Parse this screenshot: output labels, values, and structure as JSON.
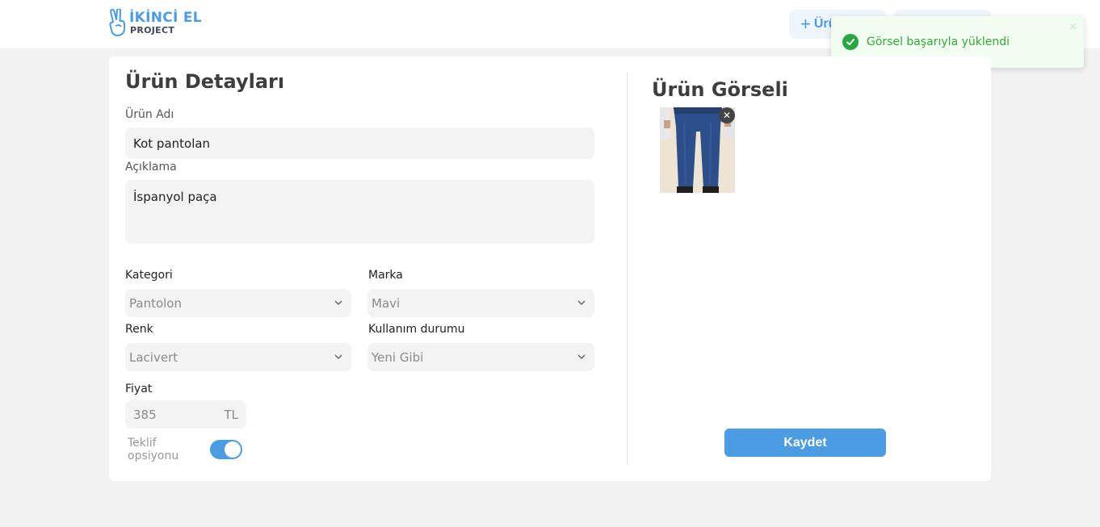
{
  "header": {
    "logo_main": "İKİNCİ EL",
    "logo_sub": "PROJECT",
    "add_button_label": "Ürün",
    "add_button_icon": "plus-icon",
    "second_button_label": ""
  },
  "toast": {
    "message": "Görsel başarıyla yüklendi",
    "icon": "check-circle-icon",
    "close_icon": "close-icon",
    "color": "#28a745"
  },
  "details": {
    "title": "Ürün Detayları",
    "name_label": "Ürün Adı",
    "name_value": "Kot pantolan",
    "description_label": "Açıklama",
    "description_value": "İspanyol paça",
    "category_label": "Kategori",
    "category_value": "Pantolon",
    "brand_label": "Marka",
    "brand_value": "Mavi",
    "color_label": "Renk",
    "color_value": "Lacivert",
    "condition_label": "Kullanım durumu",
    "condition_value": "Yeni Gibi",
    "price_label": "Fiyat",
    "price_value": "385",
    "price_currency": "TL",
    "offer_label": "Teklif opsiyonu",
    "offer_enabled": true
  },
  "image_panel": {
    "title": "Ürün Görseli",
    "image_alt": "jeans-product-image",
    "remove_icon": "close-icon",
    "save_label": "Kaydet"
  },
  "colors": {
    "accent": "#4b9ce2",
    "success": "#28a745"
  }
}
